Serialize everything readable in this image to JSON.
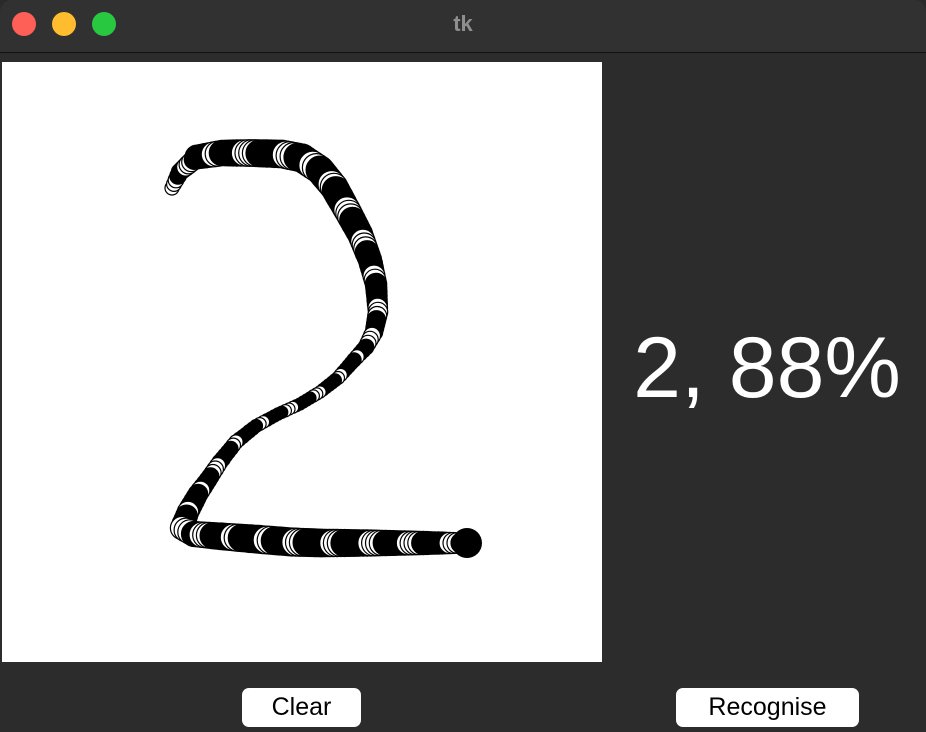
{
  "window": {
    "title": "tk"
  },
  "result": {
    "text": "2, 88%"
  },
  "buttons": {
    "clear_label": "Clear",
    "recognise_label": "Recognise"
  },
  "colors": {
    "background": "#2d2c2c",
    "canvas": "#ffffff",
    "ink": "#000000",
    "close": "#fe5f57",
    "minimize": "#febc2e",
    "maximize": "#28c840"
  }
}
